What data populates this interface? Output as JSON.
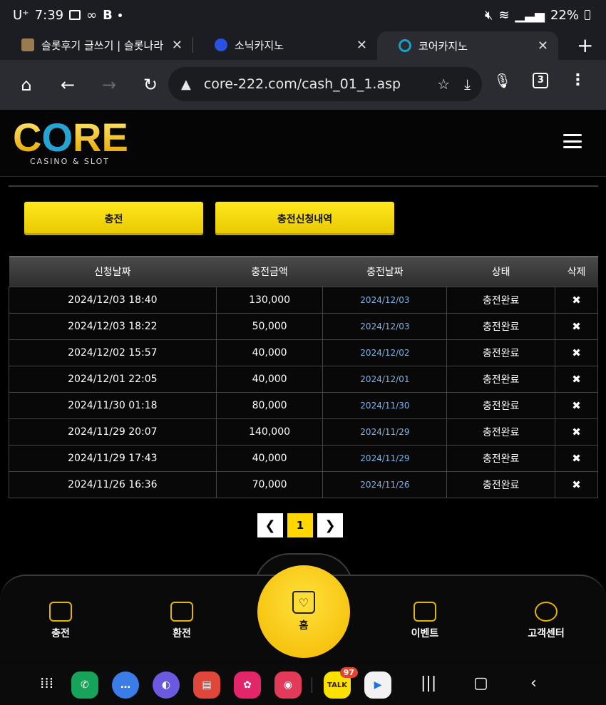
{
  "status_bar": {
    "carrier": "U⁺",
    "time": "7:39",
    "battery": "22%"
  },
  "tabs": [
    {
      "title": "슬롯후기 글쓰기 | 슬롯나라",
      "favicon_color": "#9a7b4f"
    },
    {
      "title": "소닉카지노",
      "favicon_color": "#2952e0"
    },
    {
      "title": "코어카지노",
      "favicon_color": "#1aa0c8"
    }
  ],
  "tab_count": "3",
  "url": "core-222.com/cash_01_1.asp",
  "logo": {
    "word_before": "C",
    "word_o": "O",
    "word_after": "RE",
    "sub": "CASINO & SLOT"
  },
  "buttons": {
    "charge": "충전",
    "history": "충전신청내역"
  },
  "table": {
    "headers": [
      "신청날짜",
      "충전금액",
      "충전날짜",
      "상태",
      "삭제"
    ],
    "rows": [
      {
        "request": "2024/12/03 18:40",
        "amount": "130,000",
        "date": "2024/12/03",
        "status": "충전완료"
      },
      {
        "request": "2024/12/03 18:22",
        "amount": "50,000",
        "date": "2024/12/03",
        "status": "충전완료"
      },
      {
        "request": "2024/12/02 15:57",
        "amount": "40,000",
        "date": "2024/12/02",
        "status": "충전완료"
      },
      {
        "request": "2024/12/01 22:05",
        "amount": "40,000",
        "date": "2024/12/01",
        "status": "충전완료"
      },
      {
        "request": "2024/11/30 01:18",
        "amount": "80,000",
        "date": "2024/11/30",
        "status": "충전완료"
      },
      {
        "request": "2024/11/29 20:07",
        "amount": "140,000",
        "date": "2024/11/29",
        "status": "충전완료"
      },
      {
        "request": "2024/11/29 17:43",
        "amount": "40,000",
        "date": "2024/11/29",
        "status": "충전완료"
      },
      {
        "request": "2024/11/26 16:36",
        "amount": "70,000",
        "date": "2024/11/26",
        "status": "충전완료"
      }
    ],
    "delete_glyph": "✖"
  },
  "pagination": {
    "current": "1"
  },
  "bottom_nav": {
    "charge": "충전",
    "exchange": "환전",
    "home": "홈",
    "event": "이벤트",
    "support": "고객센터"
  },
  "dock": {
    "kakao_badge": "97",
    "kakao_label": "TALK"
  },
  "colors": {
    "accent_yellow": "#ffd800",
    "date_blue": "#7fb4e6",
    "logo_blue": "#22a4d6"
  }
}
